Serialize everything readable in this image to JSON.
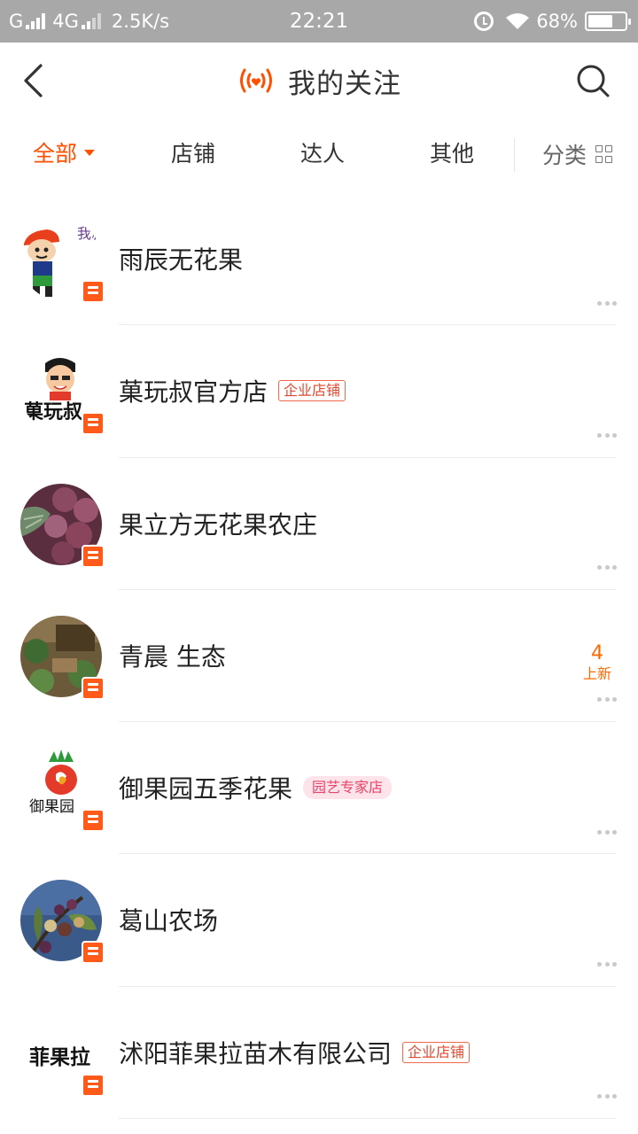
{
  "status_bar": {
    "carrier_1": "G",
    "carrier_2": "4G",
    "speed": "2.5K/s",
    "time": "22:21",
    "battery": "68%"
  },
  "header": {
    "title": "我的关注",
    "accent_color": "#ff5000"
  },
  "tabs": {
    "all": "全部",
    "shops": "店铺",
    "experts": "达人",
    "others": "其他",
    "category": "分类"
  },
  "shops": [
    {
      "name": "雨辰无花果",
      "tag": "",
      "new_count": "",
      "new_label": ""
    },
    {
      "name": "菓玩叔官方店",
      "tag": "企业店铺",
      "new_count": "",
      "new_label": ""
    },
    {
      "name": "果立方无花果农庄",
      "tag": "",
      "new_count": "",
      "new_label": ""
    },
    {
      "name": "青晨 生态",
      "tag": "",
      "new_count": "4",
      "new_label": "上新"
    },
    {
      "name": "御果园五季花果",
      "tag": "园艺专家店",
      "new_count": "",
      "new_label": ""
    },
    {
      "name": "葛山农场",
      "tag": "",
      "new_count": "",
      "new_label": ""
    },
    {
      "name": "沭阳菲果拉苗木有限公司",
      "tag": "企业店铺",
      "new_count": "",
      "new_label": ""
    }
  ],
  "avatars": {
    "avatar_1_text": "我就是",
    "avatar_2_text": "菓玩叔",
    "avatar_5_text": "御果园",
    "avatar_7_text": "菲果拉"
  }
}
